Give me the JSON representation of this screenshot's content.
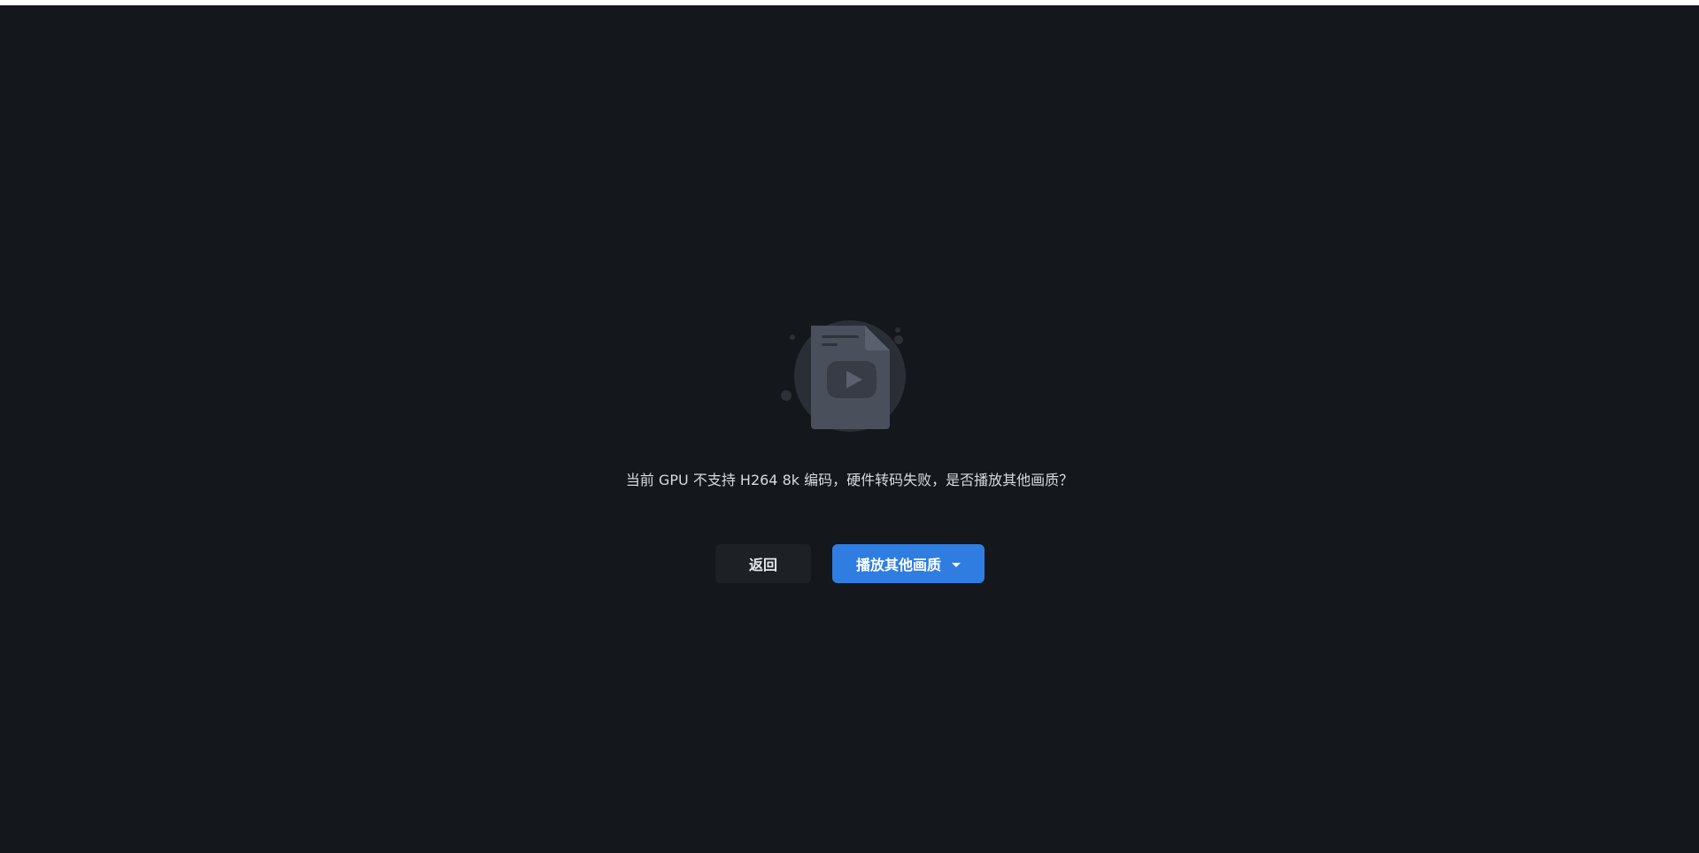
{
  "message": "当前 GPU 不支持 H264 8k 编码，硬件转码失败，是否播放其他画质？",
  "actions": {
    "back_label": "返回",
    "play_other_label": "播放其他画质"
  },
  "icons": {
    "illustration": "video-file-icon",
    "dropdown": "caret-down-icon"
  },
  "colors": {
    "background": "#14171b",
    "primary": "#2f7de1",
    "secondary_button": "#1d2126",
    "text": "#d7dae0"
  }
}
